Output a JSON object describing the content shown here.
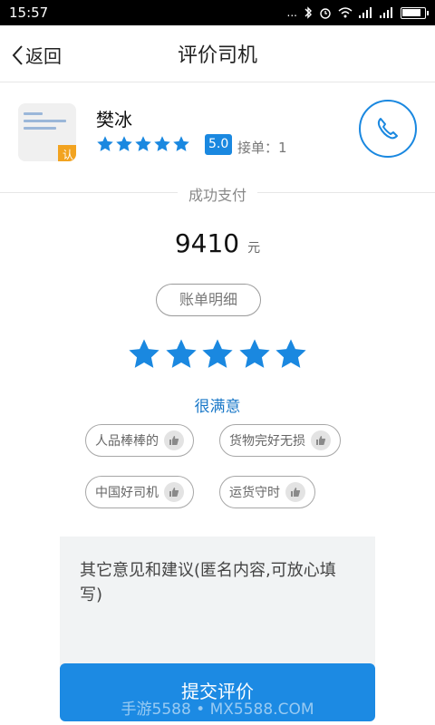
{
  "status_bar": {
    "time": "15:57",
    "icons": [
      "more-dots-icon",
      "bluetooth-icon",
      "alarm-icon",
      "wifi-icon",
      "signal-icon",
      "signal-icon",
      "battery-icon"
    ],
    "dots": "..."
  },
  "nav": {
    "back_label": "返回",
    "title": "评价司机"
  },
  "driver": {
    "name": "樊冰",
    "badge": "认",
    "star_count": 5,
    "rating": "5.0",
    "orders": "接单：1"
  },
  "payment": {
    "label": "成功支付",
    "amount": "9410",
    "unit": "元"
  },
  "bill_button": "账单明细",
  "rating": {
    "stars": 5,
    "max": 5,
    "text": "很满意"
  },
  "tags": [
    {
      "label": "人品棒棒的"
    },
    {
      "label": "货物完好无损"
    },
    {
      "label": "中国好司机"
    },
    {
      "label": "运货守时"
    }
  ],
  "comment": {
    "placeholder": "其它意见和建议(匿名内容,可放心填写)"
  },
  "submit": "提交评价",
  "watermark": "手游5588 • MX5588.COM",
  "colors": {
    "accent": "#1a88e0",
    "badge": "#f2a320",
    "satisfaction_text": "#1a78c8"
  }
}
